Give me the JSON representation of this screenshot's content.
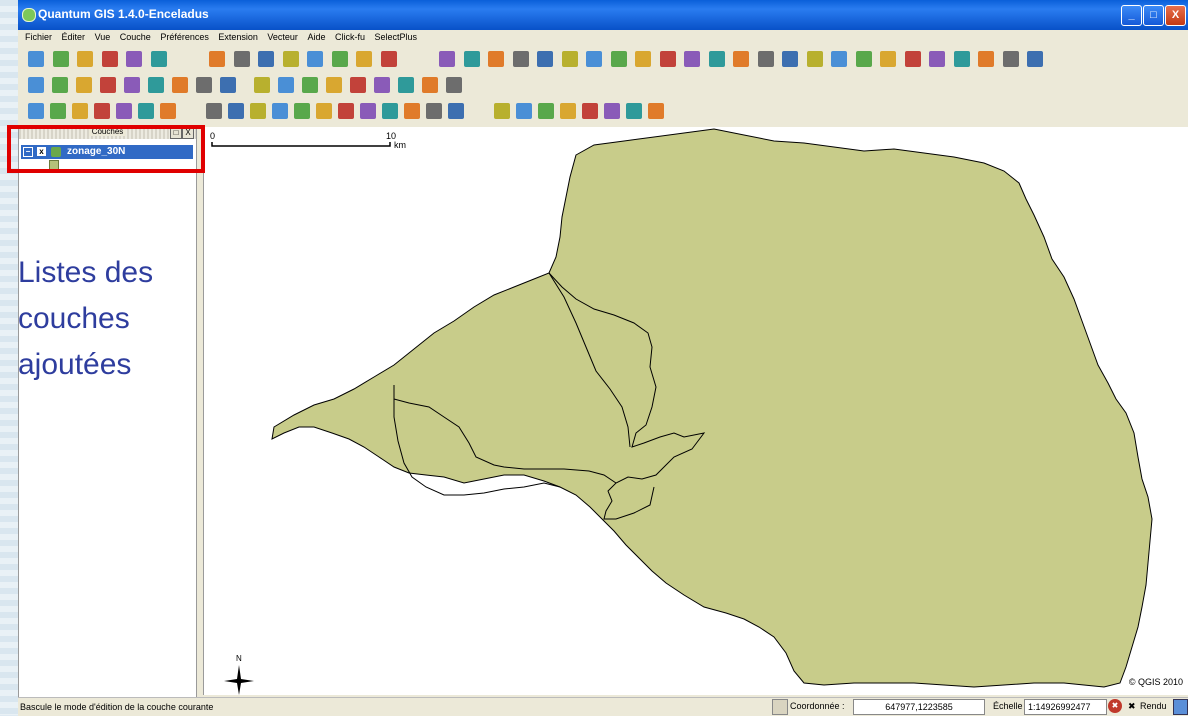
{
  "window": {
    "title": "Quantum GIS 1.4.0-Enceladus",
    "controls": {
      "minimize": "_",
      "maximize": "□",
      "close": "X"
    }
  },
  "menubar": [
    "Fichier",
    "Éditer",
    "Vue",
    "Couche",
    "Préférences",
    "Extension",
    "Vecteur",
    "Aide",
    "Click-fu",
    "SelectPlus"
  ],
  "layers_panel": {
    "title": "Couches",
    "float_button": "□",
    "close_button": "X",
    "layers": [
      {
        "name": "zonage_30N",
        "expanded": true,
        "visible": true,
        "expander": "−",
        "check": "x"
      }
    ]
  },
  "annotation": {
    "lines": [
      "Listes des",
      "couches",
      "ajoutées"
    ],
    "color": "#2e3d9e",
    "highlight_color": "#e00000"
  },
  "map": {
    "scalebar": {
      "start": "0",
      "end": "10",
      "unit": "km"
    },
    "north_arrow_label": "N",
    "credit": "© QGIS 2010",
    "fill_color": "#c8cc8a",
    "stroke_color": "#000000"
  },
  "statusbar": {
    "message": "Bascule le mode d'édition de la couche courante",
    "coordinate_label": "Coordonnée :",
    "coordinate_value": "647977,1223585",
    "scale_label": "Échelle",
    "scale_value": "1:14926992477",
    "render_label": "Rendu",
    "render_check": "✖",
    "stop_glyph": "✖"
  },
  "toolbar_icons": {
    "row1": [
      "new-project-icon",
      "open-project-icon",
      "save-project-icon",
      "save-as-icon",
      "print-composer-icon",
      "print-icon",
      "add-vector-icon",
      "add-raster-icon",
      "add-postgis-icon",
      "add-spatialite-icon",
      "add-wms-icon",
      "new-vector-icon",
      "add-wfs-icon",
      "delete-layer-icon",
      "copyright-icon",
      "north-arrow-plugin-icon",
      "scalebar-plugin-icon",
      "georeferencer-icon",
      "gps-icon",
      "grid-maker-icon",
      "globe-icon",
      "profile-icon",
      "coordinate-capture-icon",
      "compass-icon",
      "dxf-icon",
      "interpolation-icon",
      "pdf-icon",
      "edit-icon",
      "line-icon",
      "database-icon",
      "table-icon",
      "plugin-icon",
      "python-icon",
      "person-icon",
      "sql-icon",
      "gis-icon",
      "chart-icon",
      "mosaic-icon",
      "zoom-tool-icon"
    ],
    "row2": [
      "pan-map-icon",
      "identify-icon",
      "delete-selection-icon",
      "attribute-table-icon",
      "measure-line-icon",
      "measure-area-icon",
      "map-tips-icon",
      "bookmark-icon",
      "new-bookmark-icon",
      "pan-icon",
      "zoom-in-icon",
      "zoom-out-icon",
      "zoom-full-icon",
      "zoom-selection-icon",
      "zoom-layer-icon",
      "zoom-last-icon",
      "zoom-next-icon",
      "refresh-icon"
    ],
    "row3": [
      "toggle-edit-icon",
      "move-feature-icon",
      "node-tool-icon",
      "delete-selected-icon",
      "cut-icon",
      "copy-icon",
      "paste-icon",
      "undo-icon",
      "redo-icon",
      "add-ring-icon",
      "add-island-icon",
      "delete-ring-icon",
      "delete-part-icon",
      "reshape-icon",
      "split-icon",
      "merge-icon",
      "simplify-icon",
      "rotate-icon",
      "offset-icon",
      "fill-ring-icon",
      "label-icon",
      "move-label-icon",
      "rotate-label-icon",
      "diagram-icon",
      "pin-icon",
      "unpin-icon",
      "show-hide-icon"
    ]
  }
}
